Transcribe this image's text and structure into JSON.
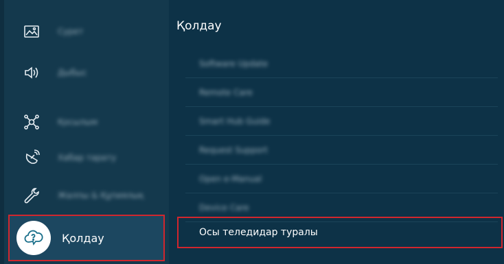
{
  "sidebar": {
    "items": [
      {
        "icon": "picture-icon",
        "label": "Сурет"
      },
      {
        "icon": "sound-icon",
        "label": "Дыбыс"
      },
      {
        "icon": "connection-icon",
        "label": "Қосылым"
      },
      {
        "icon": "broadcast-icon",
        "label": "Хабар тарату"
      },
      {
        "icon": "general-settings-icon",
        "label": "Жалпы & Құпиялық"
      }
    ],
    "selected": {
      "icon": "support-cloud-icon",
      "label": "Қолдау"
    }
  },
  "panel": {
    "title": "Қолдау",
    "items": [
      {
        "label": "Software Update"
      },
      {
        "label": "Remote Care"
      },
      {
        "label": "Smart Hub Guide"
      },
      {
        "label": "Request Support"
      },
      {
        "label": "Open e-Manual"
      },
      {
        "label": "Device Care"
      }
    ],
    "highlighted": {
      "label": "Осы теледидар туралы"
    }
  },
  "colors": {
    "background": "#0d3247",
    "sidebar": "#14394d",
    "highlight_border": "#d2262d",
    "text": "#ffffff"
  }
}
